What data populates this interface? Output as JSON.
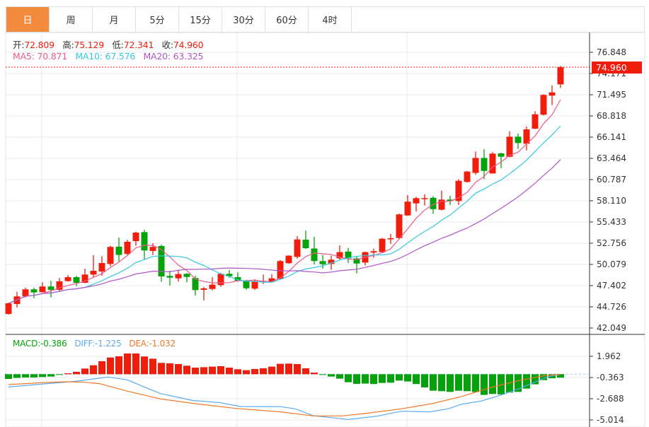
{
  "tabs": [
    {
      "label": "日",
      "active": true
    },
    {
      "label": "周"
    },
    {
      "label": "月"
    },
    {
      "label": "5分"
    },
    {
      "label": "15分"
    },
    {
      "label": "30分"
    },
    {
      "label": "60分"
    },
    {
      "label": "4时"
    }
  ],
  "ohlc": {
    "open_label": "开:",
    "open": "72.809",
    "high_label": "高:",
    "high": "75.129",
    "low_label": "低:",
    "low": "72.341",
    "close_label": "收:",
    "close": "74.960"
  },
  "ma": {
    "ma5": "MA5: 70.871",
    "ma10": "MA10: 67.576",
    "ma20": "MA20: 63.325"
  },
  "macd_legend": {
    "macd": "MACD:-0.386",
    "diff": "DIFF:-1.225",
    "dea": "DEA:-1.032"
  },
  "current_price": "74.960",
  "colors": {
    "up": "#f01c0c",
    "down": "#04a30b",
    "ma5": "#f0588c",
    "ma10": "#35c8e0",
    "ma20": "#b055c8",
    "diff": "#5aaaf0",
    "dea": "#f07828",
    "active_tab": "#f38a3c"
  },
  "chart_data": [
    {
      "type": "candlestick",
      "y_ticks": [
        "76.848",
        "74.171",
        "71.495",
        "68.818",
        "66.141",
        "63.464",
        "60.787",
        "58.110",
        "55.433",
        "52.756",
        "50.079",
        "47.402",
        "44.726",
        "42.049"
      ],
      "ylim": [
        42.049,
        76.848
      ],
      "moving_averages": [
        5,
        10,
        20
      ],
      "candles": [
        [
          43.83,
          45.26,
          43.74,
          45.17
        ],
        [
          45.08,
          46.63,
          44.64,
          46.04
        ],
        [
          46.04,
          47.16,
          45.91,
          46.93
        ],
        [
          46.93,
          47.14,
          45.82,
          46.54
        ],
        [
          46.57,
          47.82,
          46.51,
          47.29
        ],
        [
          47.29,
          48.0,
          45.91,
          46.87
        ],
        [
          46.87,
          48.36,
          46.63,
          47.94
        ],
        [
          47.97,
          48.74,
          47.91,
          48.47
        ],
        [
          48.47,
          48.65,
          47.34,
          47.76
        ],
        [
          47.76,
          49.54,
          47.7,
          48.8
        ],
        [
          48.8,
          51.24,
          48.5,
          49.27
        ],
        [
          49.18,
          51.12,
          48.65,
          50.25
        ],
        [
          50.14,
          52.43,
          49.84,
          52.29
        ],
        [
          52.32,
          53.48,
          50.45,
          51.28
        ],
        [
          51.4,
          53.18,
          51.27,
          52.94
        ],
        [
          53.02,
          54.21,
          52.43,
          54.09
        ],
        [
          54.15,
          54.45,
          50.64,
          51.84
        ],
        [
          51.78,
          52.76,
          51.27,
          52.29
        ],
        [
          52.4,
          52.58,
          47.88,
          48.56
        ],
        [
          48.63,
          49.28,
          47.4,
          48.41
        ],
        [
          48.32,
          49.39,
          47.91,
          48.86
        ],
        [
          48.89,
          49.0,
          47.82,
          48.5
        ],
        [
          48.36,
          48.65,
          46.15,
          46.84
        ],
        [
          46.87,
          47.22,
          45.53,
          47.05
        ],
        [
          46.98,
          48.47,
          46.81,
          47.52
        ],
        [
          47.47,
          49.0,
          47.25,
          48.89
        ],
        [
          48.89,
          49.36,
          48.41,
          48.59
        ],
        [
          48.47,
          49.08,
          47.91,
          48.0
        ],
        [
          48.0,
          48.14,
          46.87,
          47.07
        ],
        [
          47.02,
          48.2,
          46.87,
          47.97
        ],
        [
          47.88,
          48.8,
          47.61,
          48.0
        ],
        [
          47.88,
          48.86,
          47.82,
          48.32
        ],
        [
          48.23,
          50.64,
          48.18,
          50.5
        ],
        [
          50.23,
          51.24,
          50.17,
          51.18
        ],
        [
          51.03,
          53.65,
          50.79,
          53.23
        ],
        [
          53.2,
          54.36,
          52.02,
          52.13
        ],
        [
          52.09,
          53.56,
          50.07,
          50.5
        ],
        [
          50.5,
          51.27,
          49.54,
          50.1
        ],
        [
          50.14,
          51.18,
          49.39,
          50.67
        ],
        [
          50.84,
          52.49,
          50.63,
          51.63
        ],
        [
          51.7,
          52.17,
          50.27,
          50.84
        ],
        [
          50.84,
          51.07,
          48.93,
          50.19
        ],
        [
          50.31,
          51.7,
          49.96,
          51.63
        ],
        [
          51.57,
          52.08,
          50.92,
          51.75
        ],
        [
          51.63,
          53.41,
          51.54,
          53.32
        ],
        [
          53.3,
          53.92,
          52.67,
          53.38
        ],
        [
          53.41,
          56.5,
          53.23,
          56.39
        ],
        [
          56.26,
          58.83,
          56.21,
          58.0
        ],
        [
          57.78,
          58.62,
          56.77,
          58.44
        ],
        [
          58.35,
          58.94,
          57.51,
          58.44
        ],
        [
          58.49,
          58.7,
          56.47,
          57.06
        ],
        [
          56.98,
          59.39,
          56.89,
          58.26
        ],
        [
          58.26,
          58.74,
          57.58,
          58.08
        ],
        [
          58.08,
          60.84,
          57.58,
          60.63
        ],
        [
          60.49,
          61.88,
          60.4,
          61.8
        ],
        [
          61.63,
          64.33,
          61.4,
          63.52
        ],
        [
          63.52,
          64.62,
          60.84,
          61.88
        ],
        [
          61.56,
          64.27,
          61.56,
          64.06
        ],
        [
          64.09,
          64.18,
          62.21,
          63.67
        ],
        [
          63.67,
          66.88,
          63.58,
          66.2
        ],
        [
          66.2,
          66.58,
          64.65,
          65.4
        ],
        [
          65.31,
          67.47,
          64.47,
          67.12
        ],
        [
          67.21,
          69.41,
          67.15,
          69.02
        ],
        [
          68.97,
          71.56,
          68.88,
          71.47
        ],
        [
          71.38,
          72.68,
          70.18,
          71.79
        ],
        [
          72.809,
          75.129,
          72.341,
          74.96
        ]
      ]
    },
    {
      "type": "bar",
      "y_ticks": [
        "1.962",
        "-0.363",
        "-2.688",
        "-5.014"
      ],
      "ylim": [
        -5.4,
        3.6
      ],
      "macd": [
        -0.52,
        -0.41,
        -0.36,
        -0.36,
        -0.31,
        -0.26,
        -0.08,
        0.1,
        0.26,
        0.62,
        0.98,
        1.42,
        1.83,
        1.96,
        2.27,
        2.27,
        1.94,
        1.7,
        1.24,
        1.19,
        1.11,
        0.93,
        0.72,
        0.77,
        0.83,
        0.88,
        0.72,
        0.54,
        0.44,
        0.57,
        0.65,
        0.83,
        1.14,
        1.16,
        1.11,
        0.65,
        0.18,
        -0.08,
        -0.26,
        -0.49,
        -0.88,
        -1.06,
        -1.03,
        -1.08,
        -0.96,
        -0.93,
        -0.7,
        -0.8,
        -1.08,
        -1.45,
        -1.81,
        -1.86,
        -1.94,
        -1.81,
        -1.86,
        -1.96,
        -2.27,
        -2.17,
        -2.22,
        -2.01,
        -1.94,
        -1.58,
        -1.11,
        -0.65,
        -0.45,
        -0.386
      ],
      "diff": [
        [
          0,
          -1.4
        ],
        [
          4.6,
          -1.03
        ],
        [
          7.9,
          -0.78
        ],
        [
          11.75,
          -0.31
        ],
        [
          14,
          -0.62
        ],
        [
          15.7,
          -1.29
        ],
        [
          17.9,
          -2.12
        ],
        [
          21.75,
          -2.89
        ],
        [
          24.8,
          -3.1
        ],
        [
          27.3,
          -3.54
        ],
        [
          32,
          -3.56
        ],
        [
          33.75,
          -3.8
        ],
        [
          35.9,
          -4.55
        ],
        [
          40,
          -4.96
        ],
        [
          43.4,
          -4.6
        ],
        [
          46.25,
          -4.06
        ],
        [
          49.6,
          -4.13
        ],
        [
          51.75,
          -3.8
        ],
        [
          53.4,
          -3.28
        ],
        [
          55.7,
          -2.94
        ],
        [
          57.9,
          -2.32
        ],
        [
          60.1,
          -1.6
        ],
        [
          61.75,
          -0.96
        ],
        [
          63.4,
          -0.31
        ],
        [
          65,
          0
        ]
      ],
      "dea": [
        [
          0,
          -1.14
        ],
        [
          4.6,
          -0.9
        ],
        [
          6.75,
          -0.83
        ],
        [
          9,
          -0.88
        ],
        [
          10.7,
          -1.03
        ],
        [
          14,
          -1.86
        ],
        [
          17.9,
          -2.71
        ],
        [
          21.75,
          -3.2
        ],
        [
          26.75,
          -3.75
        ],
        [
          32,
          -4.13
        ],
        [
          35.9,
          -4.57
        ],
        [
          39.25,
          -4.57
        ],
        [
          42,
          -4.31
        ],
        [
          46.25,
          -3.8
        ],
        [
          50,
          -3.2
        ],
        [
          53.4,
          -2.43
        ],
        [
          56.75,
          -1.47
        ],
        [
          60.1,
          -0.7
        ],
        [
          63,
          -0.18
        ],
        [
          65,
          0
        ]
      ]
    }
  ]
}
